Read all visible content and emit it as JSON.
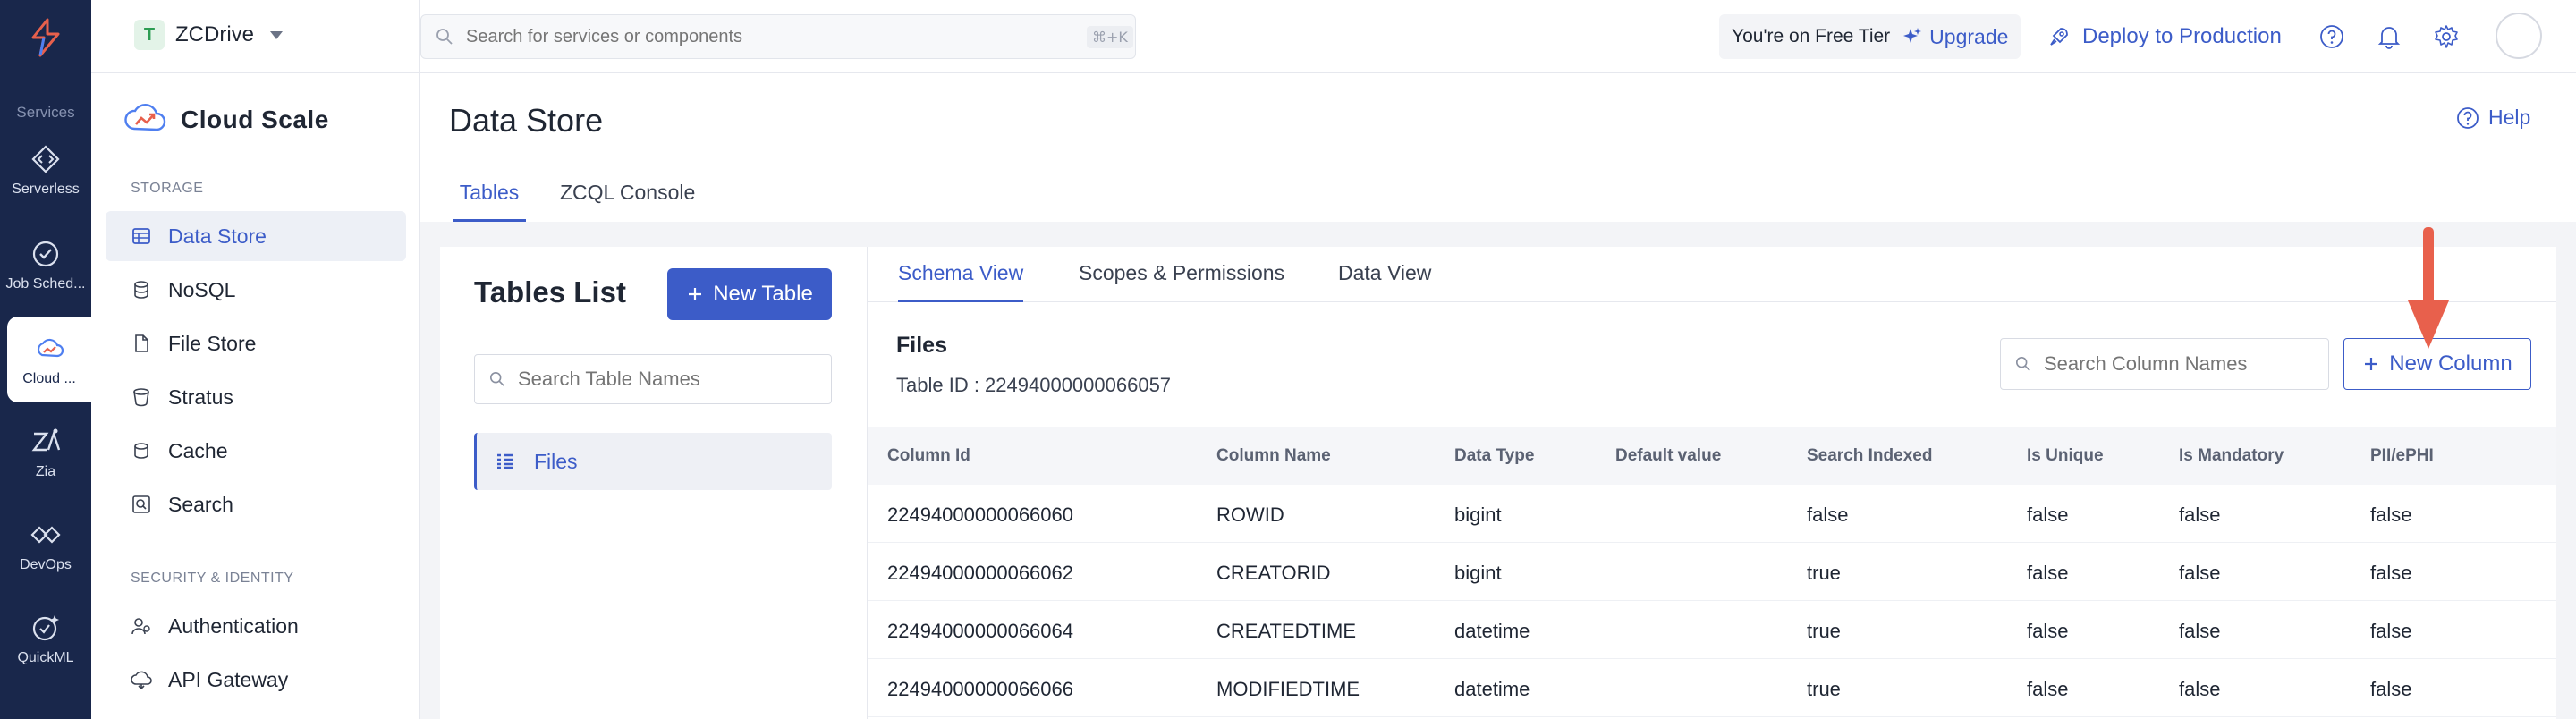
{
  "colors": {
    "accent": "#3c5cc8",
    "rail_bg": "#19274b",
    "arrow": "#e8604c",
    "project_badge": "#2c9c52"
  },
  "rail": {
    "section_label": "Services",
    "items": [
      {
        "label": "Serverless",
        "icon": "code-brackets-icon"
      },
      {
        "label": "Job Sched...",
        "icon": "check-clock-icon"
      },
      {
        "label": "Cloud ...",
        "icon": "cloud-scale-icon"
      },
      {
        "label": "Zia",
        "icon": "zia-icon"
      },
      {
        "label": "DevOps",
        "icon": "devops-icon"
      },
      {
        "label": "QuickML",
        "icon": "quickml-icon"
      }
    ]
  },
  "project": {
    "initial": "T",
    "name": "ZCDrive"
  },
  "sidebar": {
    "title": "Cloud Scale",
    "groups": [
      {
        "label": "STORAGE",
        "items": [
          {
            "label": "Data Store",
            "icon": "table-icon",
            "active": true
          },
          {
            "label": "NoSQL",
            "icon": "database-icon",
            "active": false
          },
          {
            "label": "File Store",
            "icon": "file-icon",
            "active": false
          },
          {
            "label": "Stratus",
            "icon": "bucket-icon",
            "active": false
          },
          {
            "label": "Cache",
            "icon": "cache-icon",
            "active": false
          },
          {
            "label": "Search",
            "icon": "search-box-icon",
            "active": false
          }
        ]
      },
      {
        "label": "SECURITY & IDENTITY",
        "items": [
          {
            "label": "Authentication",
            "icon": "users-icon",
            "active": false
          },
          {
            "label": "API Gateway",
            "icon": "gateway-icon",
            "active": false
          }
        ]
      }
    ]
  },
  "topbar": {
    "search_placeholder": "Search for services or components",
    "shortcut": "⌘+K",
    "tier_text": "You're on Free Tier",
    "upgrade_label": "Upgrade",
    "deploy_label": "Deploy to Production"
  },
  "page": {
    "title": "Data Store",
    "help_label": "Help",
    "tabs": [
      "Tables",
      "ZCQL Console"
    ]
  },
  "tables_list": {
    "title": "Tables List",
    "new_table_label": "New Table",
    "search_placeholder": "Search Table Names",
    "items": [
      "Files"
    ]
  },
  "schema": {
    "tabs": [
      "Schema View",
      "Scopes & Permissions",
      "Data View"
    ],
    "table_name": "Files",
    "table_id": "Table ID : 22494000000066057",
    "search_placeholder": "Search Column Names",
    "new_column_label": "New Column",
    "columns": [
      "Column Id",
      "Column Name",
      "Data Type",
      "Default value",
      "Search Indexed",
      "Is Unique",
      "Is Mandatory",
      "PII/ePHI"
    ],
    "rows": [
      [
        "22494000000066060",
        "ROWID",
        "bigint",
        "",
        "false",
        "false",
        "false",
        "false"
      ],
      [
        "22494000000066062",
        "CREATORID",
        "bigint",
        "",
        "true",
        "false",
        "false",
        "false"
      ],
      [
        "22494000000066064",
        "CREATEDTIME",
        "datetime",
        "",
        "true",
        "false",
        "false",
        "false"
      ],
      [
        "22494000000066066",
        "MODIFIEDTIME",
        "datetime",
        "",
        "true",
        "false",
        "false",
        "false"
      ]
    ]
  }
}
